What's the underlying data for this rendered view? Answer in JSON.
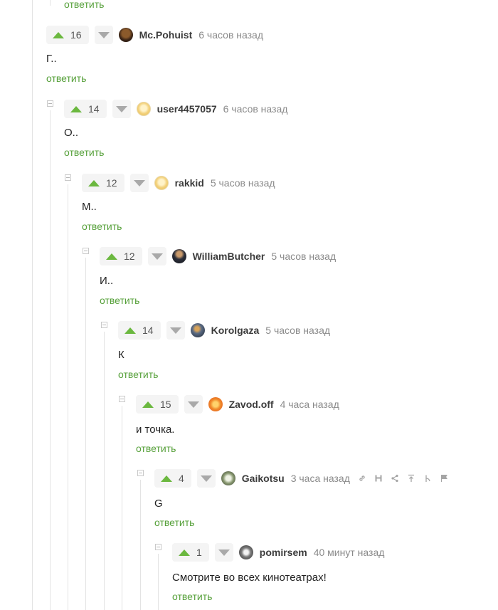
{
  "top_reply": "ответить",
  "comments": [
    {
      "score": "16",
      "user": "Mc.Pohuist",
      "time": "6 часов назад",
      "text": "Г..",
      "reply": "ответить"
    },
    {
      "score": "14",
      "user": "user4457057",
      "time": "6 часов назад",
      "text": "О..",
      "reply": "ответить"
    },
    {
      "score": "12",
      "user": "rakkid",
      "time": "5 часов назад",
      "text": "М..",
      "reply": "ответить"
    },
    {
      "score": "12",
      "user": "WilliamButcher",
      "time": "5 часов назад",
      "text": "И..",
      "reply": "ответить"
    },
    {
      "score": "14",
      "user": "Korolgaza",
      "time": "5 часов назад",
      "text": "К",
      "reply": "ответить"
    },
    {
      "score": "15",
      "user": "Zavod.off",
      "time": "4 часа назад",
      "text": "и точка.",
      "reply": "ответить"
    },
    {
      "score": "4",
      "user": "Gaikotsu",
      "time": "3 часа назад",
      "text": "G",
      "reply": "ответить"
    },
    {
      "score": "1",
      "user": "pomirsem",
      "time": "40 минут назад",
      "text": "Смотрите во всех кинотеатрах!",
      "reply": "ответить"
    }
  ]
}
